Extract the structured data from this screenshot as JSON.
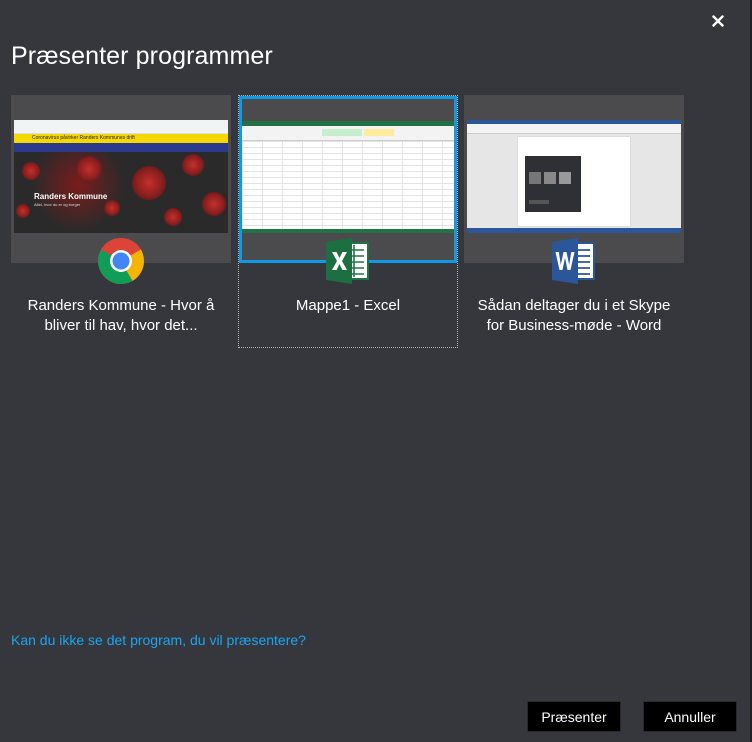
{
  "dialog": {
    "title": "Præsenter programmer",
    "close_icon": "close-icon"
  },
  "apps": [
    {
      "label": "Randers Kommune - Hvor å bliver til hav, hvor det...",
      "icon": "chrome-icon",
      "selected": false,
      "thumbnail": {
        "banner_text": "Coronavirus påvirker Randers Kommunes drift",
        "page_title": "Randers Kommune",
        "page_subtitle": "Altid, hvor du er og borger"
      }
    },
    {
      "label": "Mappe1 - Excel",
      "icon": "excel-icon",
      "selected": true
    },
    {
      "label": "Sådan deltager du i et Skype for Business-møde - Word",
      "icon": "word-icon",
      "selected": false
    }
  ],
  "help_link": "Kan du ikke se det program, du vil præsentere?",
  "buttons": {
    "present": "Præsenter",
    "cancel": "Annuller"
  },
  "colors": {
    "background": "#36373c",
    "selection": "#0f9ae6",
    "link": "#1aa5f0",
    "button": "#000000"
  }
}
